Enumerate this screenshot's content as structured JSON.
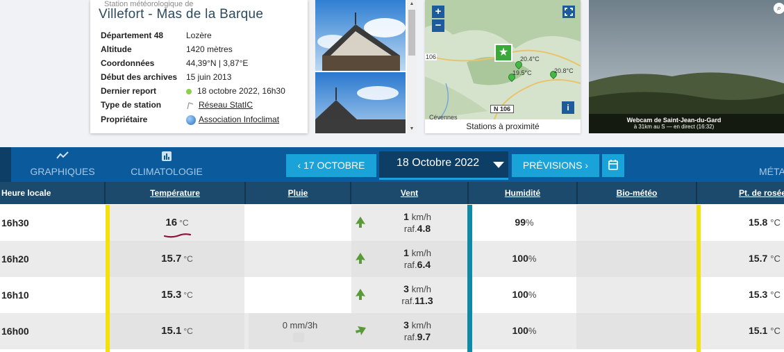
{
  "station": {
    "subtitle": "Station météorologique de",
    "name": "Villefort - Mas de la Barque",
    "details": [
      {
        "key": "Département 48",
        "value": "Lozère"
      },
      {
        "key": "Altitude",
        "value": "1420 mètres"
      },
      {
        "key": "Coordonnées",
        "value": "44,39°N | 3,87°E"
      },
      {
        "key": "Début des archives",
        "value": "15 juin 2013"
      },
      {
        "key": "Dernier report",
        "value": "18 octobre 2022, 16h30"
      },
      {
        "key": "Type de station",
        "value": "Réseau StatIC"
      },
      {
        "key": "Propriétaire",
        "value": "Association Infoclimat"
      }
    ]
  },
  "map": {
    "caption": "Stations à proximité",
    "zoom_in": "+",
    "zoom_out": "−",
    "info": "i",
    "road": "N 106",
    "markers": [
      "20.4°C",
      "19.5°C",
      "20.8°C"
    ],
    "place": "Cévennes",
    "edge_label": "106"
  },
  "webcam": {
    "title": "Webcam de Saint-Jean-du-Gard",
    "subtitle": "à 31km au S — en direct (16:32)"
  },
  "nav": {
    "graphiques": "GRAPHIQUES",
    "climatologie": "CLIMATOLOGIE",
    "prev": "17 OCTOBRE",
    "date": "18 Octobre 2022",
    "next": "PRÉVISIONS",
    "meta": "MÉTA"
  },
  "table": {
    "headers": {
      "time": "Heure locale",
      "temp": "Température",
      "rain": "Pluie",
      "wind": "Vent",
      "hum": "Humidité",
      "bio": "Bio-météo",
      "dew": "Pt. de rosée"
    },
    "units": {
      "temp": "°C",
      "wind": "km/h",
      "gust": "raf.",
      "hum": "%"
    },
    "rows": [
      {
        "time": "16h30",
        "temp": "16",
        "rain": "",
        "wind": "1",
        "gust": "4.8",
        "hum": "99",
        "dew": "15.8"
      },
      {
        "time": "16h20",
        "temp": "15.7",
        "rain": "",
        "wind": "1",
        "gust": "6.4",
        "hum": "100",
        "dew": "15.7"
      },
      {
        "time": "16h10",
        "temp": "15.3",
        "rain": "",
        "wind": "3",
        "gust": "11.3",
        "hum": "100",
        "dew": "15.3"
      },
      {
        "time": "16h00",
        "temp": "15.1",
        "rain": "0 mm/3h",
        "wind": "3",
        "gust": "9.7",
        "hum": "100",
        "dew": "15.1"
      }
    ]
  },
  "colors": {
    "nav_bg": "#0a5a9c",
    "header_bg": "#1c4a6c",
    "accent_button": "#1aa3d8",
    "temp_bar": "#f2e10a",
    "hum_bar": "#0e8aa8"
  }
}
